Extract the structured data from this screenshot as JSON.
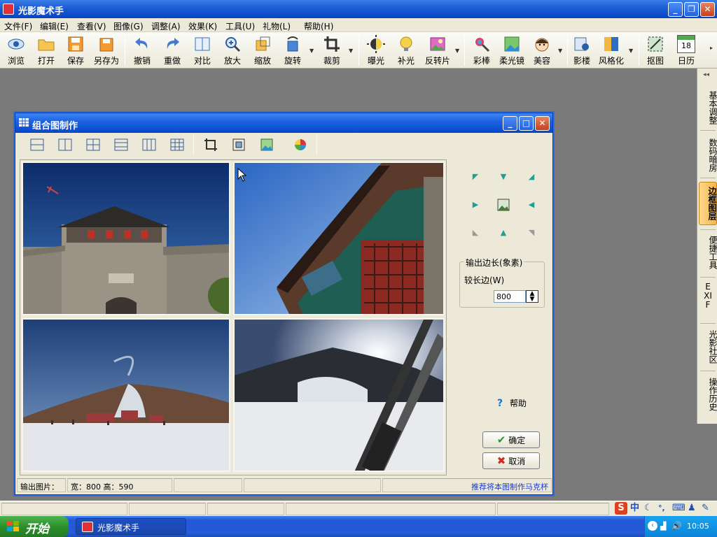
{
  "app": {
    "title": "光影魔术手"
  },
  "menu": [
    "文件(F)",
    "编辑(E)",
    "查看(V)",
    "图像(G)",
    "调整(A)",
    "效果(K)",
    "工具(U)",
    "礼物(L)",
    "帮助(H)"
  ],
  "toolbar": {
    "buttons": [
      "浏览",
      "打开",
      "保存",
      "另存为",
      "撤销",
      "重做",
      "对比",
      "放大",
      "缩放",
      "旋转",
      "裁剪",
      "曝光",
      "补光",
      "反转片",
      "彩棒",
      "柔光镜",
      "美容",
      "影楼",
      "风格化",
      "抠图",
      "日历"
    ],
    "calendar_day": "18"
  },
  "sidepanel": {
    "tabs": [
      "基本调整",
      "数码暗房",
      "边框图层",
      "便捷工具",
      "EXIF",
      "光影社区",
      "操作历史"
    ],
    "active": "边框图层"
  },
  "dialog": {
    "title": "组合图制作",
    "output_group_label": "输出边长(象素)",
    "long_side_label": "较长边(W)",
    "long_side_value": "800",
    "help_label": "帮助",
    "ok_label": "确定",
    "cancel_label": "取消",
    "status": {
      "output_label": "输出图片：",
      "dimensions": "宽：800   高：590",
      "promo_link": "推荐将本图制作马克杯"
    }
  },
  "taskbar": {
    "start_label": "开始",
    "task_label": "光影魔术手",
    "clock": "10:05"
  },
  "ime": {
    "mode": "中"
  }
}
